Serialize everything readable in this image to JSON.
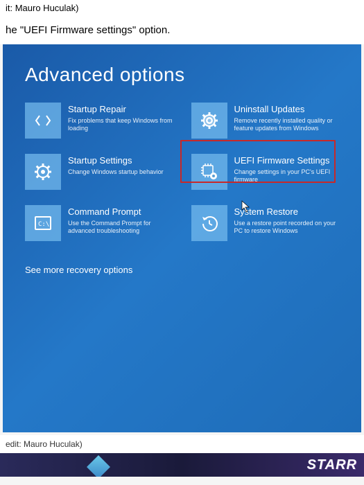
{
  "article": {
    "top_credit": "it: Mauro Huculak)",
    "instruction_prefix": "he ",
    "instruction_bold": "\"UEFI Firmware settings\"",
    "instruction_suffix": " option.",
    "bottom_credit": "edit: Mauro Huculak)"
  },
  "winre": {
    "title": "Advanced options",
    "tiles": [
      {
        "title": "Startup Repair",
        "desc": "Fix problems that keep Windows from loading"
      },
      {
        "title": "Uninstall Updates",
        "desc": "Remove recently installed quality or feature updates from Windows"
      },
      {
        "title": "Startup Settings",
        "desc": "Change Windows startup behavior"
      },
      {
        "title": "UEFI Firmware Settings",
        "desc": "Change settings in your PC's UEFI firmware"
      },
      {
        "title": "Command Prompt",
        "desc": "Use the Command Prompt for advanced troubleshooting"
      },
      {
        "title": "System Restore",
        "desc": "Use a restore point recorded on your PC to restore Windows"
      }
    ],
    "see_more": "See more recovery options"
  },
  "banner": {
    "text": "STARR"
  }
}
